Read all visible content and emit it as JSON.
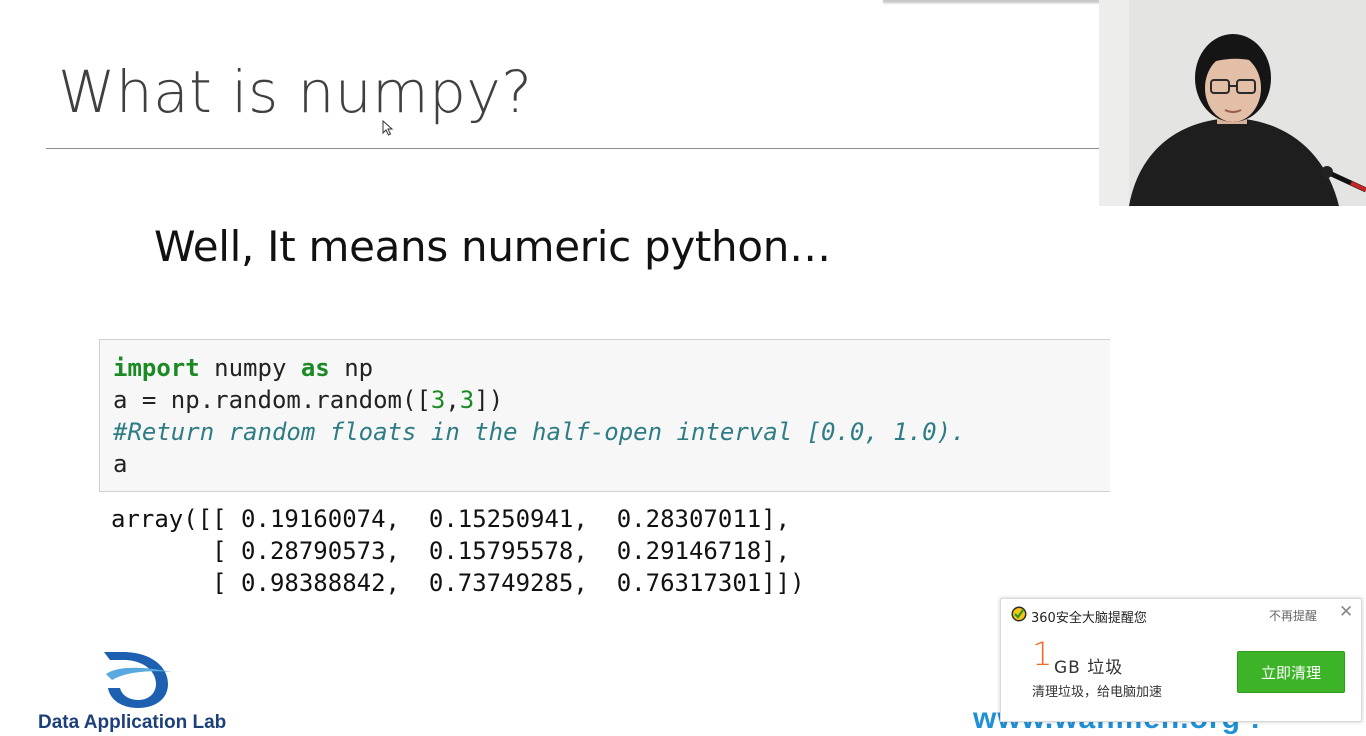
{
  "slide": {
    "title": "What is numpy?",
    "subtitle": "Well, It means numeric python…"
  },
  "code_cell": {
    "line1": {
      "kw1": "import",
      "text1": " numpy ",
      "kw2": "as",
      "text2": " np"
    },
    "line2": {
      "text1": "a = np.random.random([",
      "num1": "3",
      "text2": ",",
      "num2": "3",
      "text3": "])"
    },
    "line3": "#Return random floats in the half-open interval [0.0, 1.0).",
    "line4": "a"
  },
  "output": [
    "array([[ 0.19160074,  0.15250941,  0.28307011],",
    "       [ 0.28790573,  0.15795578,  0.29146718],",
    "       [ 0.98388842,  0.73749285,  0.76317301]])"
  ],
  "branding": {
    "logo_text": "Data Application Lab",
    "website": "www.wanmen.org !"
  },
  "popup": {
    "title": "360安全大脑提醒您",
    "dismiss_label": "不再提醒",
    "close_symbol": "✕",
    "amount_number": "1",
    "amount_unit": "GB 垃圾",
    "description": "清理垃圾，给电脑加速",
    "action_label": "立即清理"
  },
  "colors": {
    "keyword": "#1b8a24",
    "comment": "#2e7d84",
    "popup_button": "#3db427",
    "popup_amount": "#f06a24",
    "logo_blue": "#1d3f7a",
    "website_blue": "#1f8fd6"
  },
  "icons": {
    "cursor": "mouse-pointer-icon",
    "popup_header": "360-shield-icon",
    "close": "close-icon"
  }
}
